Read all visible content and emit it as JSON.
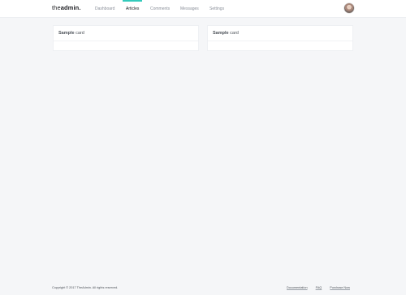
{
  "header": {
    "logo_light": "the",
    "logo_bold": "admin.",
    "nav": [
      {
        "label": "Dashboard",
        "active": false
      },
      {
        "label": "Articles",
        "active": true
      },
      {
        "label": "Comments",
        "active": false
      },
      {
        "label": "Messages",
        "active": false
      },
      {
        "label": "Settings",
        "active": false
      }
    ],
    "accent_color": "#33cabb"
  },
  "cards": [
    {
      "title_strong": "Sample",
      "title_rest": " card"
    },
    {
      "title_strong": "Sample",
      "title_rest": " card"
    }
  ],
  "footer": {
    "copyright": "Copyright © 2017 TheAdmin. All rights reserved.",
    "links": [
      "Documentation",
      "FAQ",
      "Purchase Now"
    ]
  }
}
